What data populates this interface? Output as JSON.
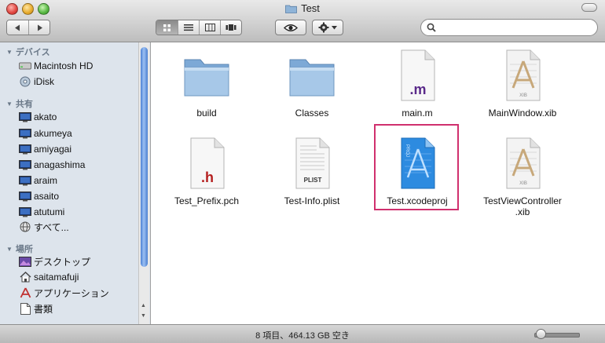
{
  "window": {
    "title": "Test"
  },
  "toolbar": {
    "back_icon": "triangle-left-icon",
    "forward_icon": "triangle-right-icon",
    "view_modes": [
      "icon-view",
      "list-view",
      "column-view",
      "cover-flow"
    ],
    "active_view": "icon-view",
    "quicklook_icon": "eye-icon",
    "action_icon": "gear-icon",
    "search_placeholder": ""
  },
  "sidebar": {
    "sections": [
      {
        "title": "デバイス",
        "items": [
          {
            "label": "Macintosh HD",
            "icon": "hard-disk-icon"
          },
          {
            "label": "iDisk",
            "icon": "idisk-icon"
          }
        ]
      },
      {
        "title": "共有",
        "items": [
          {
            "label": "akato",
            "icon": "monitor-icon"
          },
          {
            "label": "akumeya",
            "icon": "monitor-icon"
          },
          {
            "label": "amiyagai",
            "icon": "monitor-icon"
          },
          {
            "label": "anagashima",
            "icon": "monitor-icon"
          },
          {
            "label": "araim",
            "icon": "monitor-icon"
          },
          {
            "label": "asaito",
            "icon": "monitor-icon"
          },
          {
            "label": "atutumi",
            "icon": "monitor-icon"
          },
          {
            "label": "すべて...",
            "icon": "network-globe-icon"
          }
        ]
      },
      {
        "title": "場所",
        "items": [
          {
            "label": "デスクトップ",
            "icon": "desktop-icon"
          },
          {
            "label": "saitamafuji",
            "icon": "home-icon"
          },
          {
            "label": "アプリケーション",
            "icon": "applications-icon"
          },
          {
            "label": "書類",
            "icon": "documents-icon"
          }
        ]
      }
    ]
  },
  "files": [
    {
      "name": "build",
      "name2": "",
      "type": "folder",
      "badge": ""
    },
    {
      "name": "Classes",
      "name2": "",
      "type": "folder",
      "badge": ""
    },
    {
      "name": "main.m",
      "name2": "",
      "type": "m-file",
      "badge": ".m"
    },
    {
      "name": "MainWindow.xib",
      "name2": "",
      "type": "xib",
      "badge": "XIB"
    },
    {
      "name": "Test_Prefix.pch",
      "name2": "",
      "type": "h-file",
      "badge": ".h"
    },
    {
      "name": "Test-Info.plist",
      "name2": "",
      "type": "plist",
      "badge": "PLIST"
    },
    {
      "name": "Test.xcodeproj",
      "name2": "",
      "type": "xcodeproj",
      "badge": "PROJ"
    },
    {
      "name": "TestViewController",
      "name2": ".xib",
      "type": "xib",
      "badge": "XIB"
    }
  ],
  "highlighted_file": "Test.xcodeproj",
  "status": {
    "text": "8 項目、464.13 GB 空き"
  },
  "colors": {
    "highlight": "#d0306e",
    "sidebar_bg": "#dde4ec",
    "m_badge": "#5a2a8a",
    "h_badge": "#b52020"
  }
}
